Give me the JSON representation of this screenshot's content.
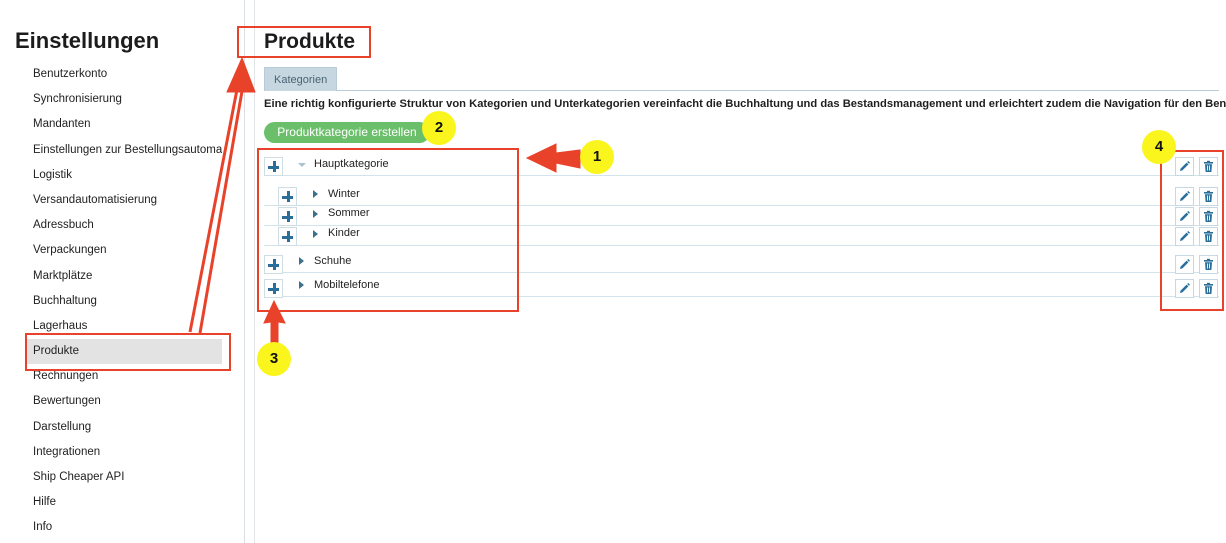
{
  "sidebar": {
    "title": "Einstellungen",
    "items": [
      {
        "label": "Benutzerkonto"
      },
      {
        "label": "Synchronisierung"
      },
      {
        "label": "Mandanten"
      },
      {
        "label": "Einstellungen zur Bestellungsautomat"
      },
      {
        "label": "Logistik"
      },
      {
        "label": "Versandautomatisierung"
      },
      {
        "label": "Adressbuch"
      },
      {
        "label": "Verpackungen"
      },
      {
        "label": "Marktplätze"
      },
      {
        "label": "Buchhaltung"
      },
      {
        "label": "Lagerhaus"
      },
      {
        "label": "Produkte",
        "active": true
      },
      {
        "label": "Rechnungen"
      },
      {
        "label": "Bewertungen"
      },
      {
        "label": "Darstellung"
      },
      {
        "label": "Integrationen"
      },
      {
        "label": "Ship Cheaper API"
      },
      {
        "label": "Hilfe"
      },
      {
        "label": "Info"
      }
    ]
  },
  "main": {
    "title": "Produkte",
    "tab_label": "Kategorien",
    "description": "Eine richtig konfigurierte Struktur von Kategorien und Unterkategorien vereinfacht die Buchhaltung und das Bestandsmanagement und erleichtert zudem die Navigation für den Benutzer",
    "create_button": "Produktkategorie erstellen"
  },
  "categories": [
    {
      "label": "Hauptkategorie",
      "expanded": true,
      "level": 0
    },
    {
      "label": "Winter",
      "level": 1
    },
    {
      "label": "Sommer",
      "level": 1
    },
    {
      "label": "Kinder",
      "level": 1
    },
    {
      "label": "Schuhe",
      "level": 0
    },
    {
      "label": "Mobiltelefone",
      "level": 0
    }
  ],
  "annotations": {
    "badge1": "1",
    "badge2": "2",
    "badge3": "3",
    "badge4": "4",
    "highlight_color": "#e8432a",
    "badge_color": "#f9f51d"
  },
  "colors": {
    "accent_green": "#6bbf6b",
    "tab_bg": "#c6d7e1",
    "icon_blue": "#2a6f99"
  }
}
